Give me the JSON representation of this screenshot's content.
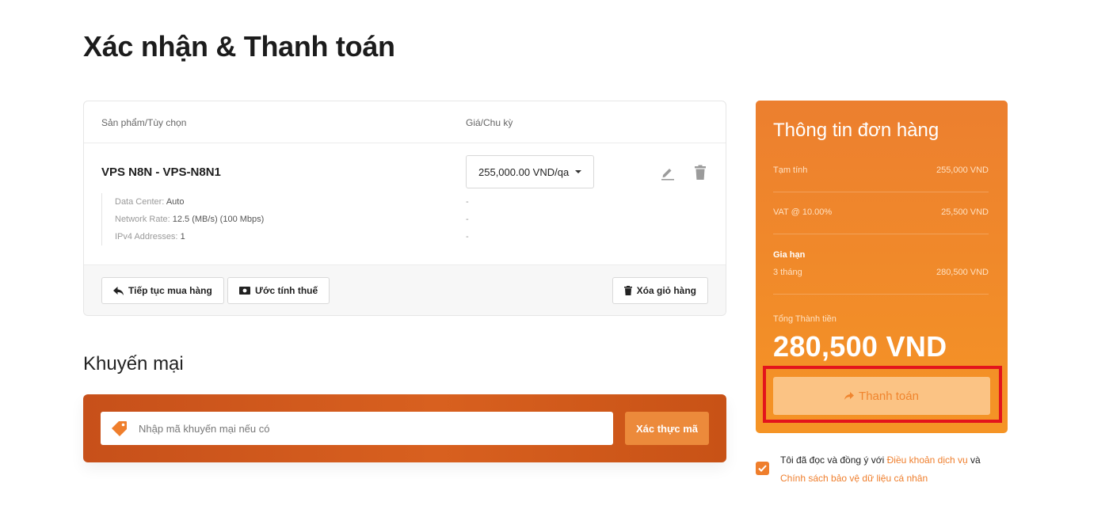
{
  "page": {
    "title": "Xác nhận & Thanh toán"
  },
  "cart": {
    "col_product": "Sản phẩm/Tùy chọn",
    "col_price": "Giá/Chu kỳ",
    "product_name": "VPS N8N - VPS-N8N1",
    "price_cycle": "255,000.00 VND/qa",
    "options": [
      {
        "label": "Data Center:",
        "value": "Auto",
        "price": "-"
      },
      {
        "label": "Network Rate:",
        "value": "12.5 (MB/s) (100 Mbps)",
        "price": "-"
      },
      {
        "label": "IPv4 Addresses:",
        "value": "1",
        "price": "-"
      }
    ],
    "continue_label": "Tiếp tục mua hàng",
    "estimate_tax_label": "Ước tính thuế",
    "clear_cart_label": "Xóa giỏ hàng"
  },
  "promo": {
    "title": "Khuyến mại",
    "placeholder": "Nhập mã khuyến mại nếu có",
    "validate_label": "Xác thực mã"
  },
  "summary": {
    "title": "Thông tin đơn hàng",
    "subtotal_label": "Tạm tính",
    "subtotal_value": "255,000 VND",
    "vat_label": "VAT @ 10.00%",
    "vat_value": "25,500 VND",
    "renewal_label": "Gia hạn",
    "renewal_period": "3 tháng",
    "renewal_value": "280,500 VND",
    "total_label": "Tổng Thành tiền",
    "total_value": "280,500 VND",
    "pay_label": "Thanh toán"
  },
  "terms": {
    "prefix": "Tôi đã đọc và đồng ý với",
    "tos_link": "Điều khoản dịch vụ",
    "and": "và",
    "privacy_link": "Chính sách bảo vệ dữ liệu cá nhân"
  },
  "colors": {
    "accent": "#ef7e2c",
    "promo_bg": "#d35a1c",
    "highlight": "#e3141c"
  }
}
